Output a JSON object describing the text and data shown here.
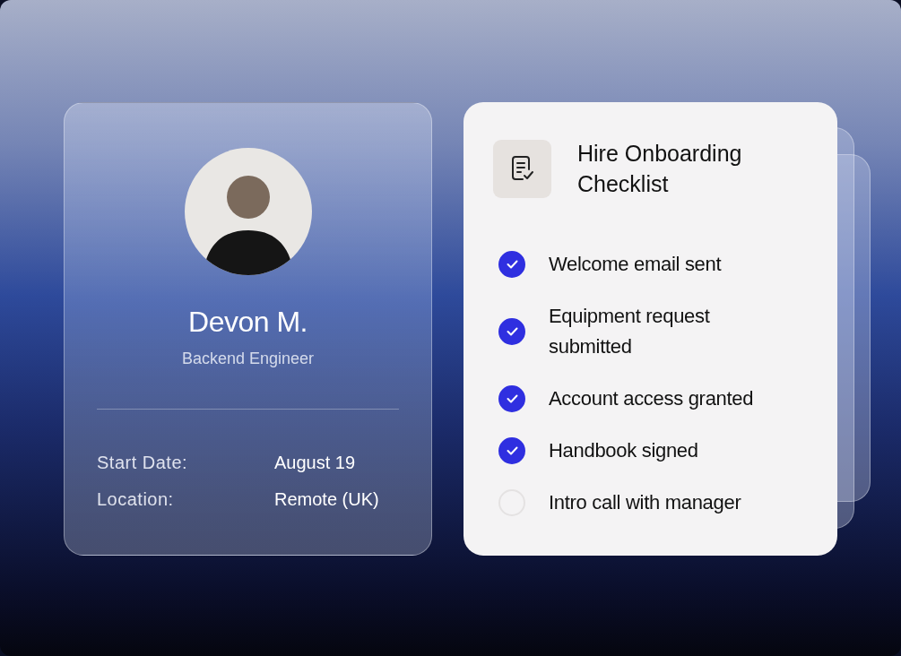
{
  "profile": {
    "name": "Devon M.",
    "role": "Backend Engineer",
    "details": [
      {
        "label": "Start Date:",
        "value": "August 19"
      },
      {
        "label": "Location:",
        "value": "Remote (UK)"
      }
    ]
  },
  "checklist": {
    "title": "Hire Onboarding Checklist",
    "items": [
      {
        "label": "Welcome email sent",
        "checked": true
      },
      {
        "label": "Equipment request submitted",
        "checked": true
      },
      {
        "label": "Account access granted",
        "checked": true
      },
      {
        "label": "Handbook signed",
        "checked": true
      },
      {
        "label": "Intro call with manager",
        "checked": false
      }
    ]
  }
}
